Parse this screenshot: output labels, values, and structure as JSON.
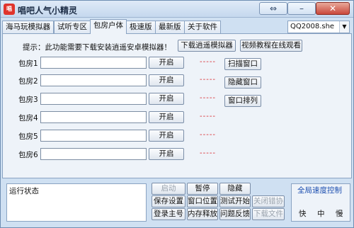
{
  "window": {
    "icon_text": "唱",
    "title": "唱吧人气小精灵",
    "restore_glyph": "⇔",
    "min_glyph": "–",
    "close_glyph": "✕"
  },
  "tabs": [
    {
      "label": "海马玩模拟器"
    },
    {
      "label": "试听专区"
    },
    {
      "label": "包房户体"
    },
    {
      "label": "极速版"
    },
    {
      "label": "最新版"
    },
    {
      "label": "关于软件"
    }
  ],
  "profile": {
    "value": "QQ2008.she",
    "caret": "▼"
  },
  "panel": {
    "hint": "提示：此功能需要下载安装逍遥安卓模拟器！",
    "download_btn": "下载逍遥模拟器",
    "video_btn": "视频教程在线观看",
    "scan_btn": "扫描窗口",
    "hide_btn": "隐藏窗口",
    "arrange_btn": "窗口排列",
    "rooms": [
      {
        "label": "包房1",
        "open": "开启",
        "status": "-----"
      },
      {
        "label": "包房2",
        "open": "开启",
        "status": "-----"
      },
      {
        "label": "包房3",
        "open": "开启",
        "status": "-----"
      },
      {
        "label": "包房4",
        "open": "开启",
        "status": "-----"
      },
      {
        "label": "包房5",
        "open": "开启",
        "status": "-----"
      },
      {
        "label": "包房6",
        "open": "开启",
        "status": "-----"
      }
    ]
  },
  "status": {
    "title": "运行状态"
  },
  "controls": {
    "start": "启动",
    "pause": "暂停",
    "hide": "隐藏",
    "save": "保存设置",
    "window_pos": "窗口位置",
    "test_start": "测试开始",
    "close_sub": "关闭错协",
    "login": "登录主号",
    "mem_release": "内存释放",
    "feedback": "问题反馈",
    "download_file": "下载文件"
  },
  "speed": {
    "title": "全局速度控制",
    "options": [
      "快",
      "中",
      "慢"
    ]
  },
  "colors": {
    "accent": "#1c4fb0",
    "status_red": "#d8262a",
    "window_bg": "#cfe0f2"
  }
}
